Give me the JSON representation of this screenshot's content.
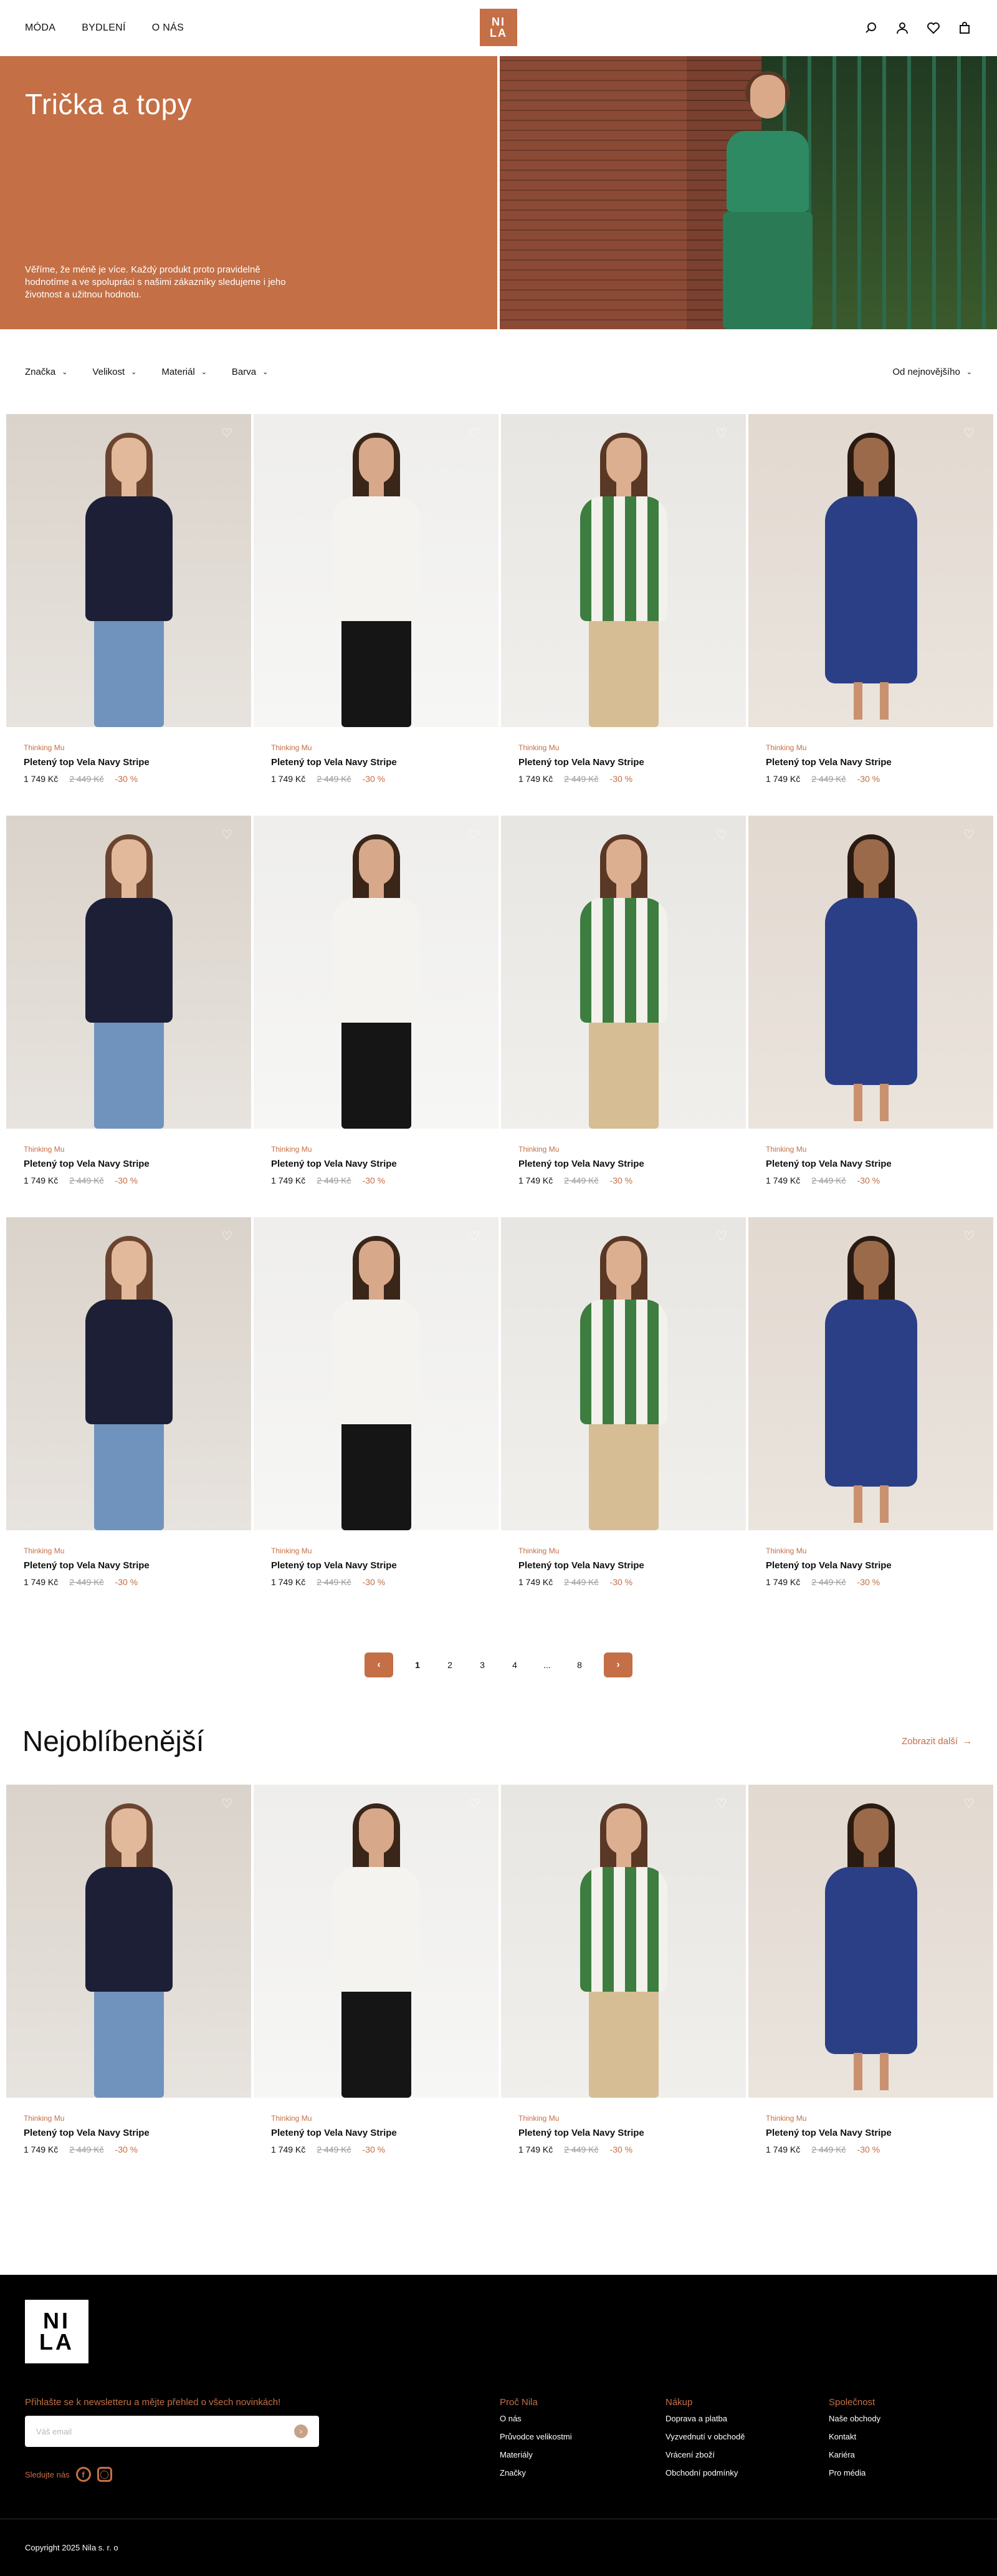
{
  "header": {
    "nav": [
      "MÓDA",
      "BYDLENÍ",
      "O NÁS"
    ],
    "logo_top": "NI",
    "logo_bottom": "LA",
    "icons": [
      "search-icon",
      "user-icon",
      "heart-icon",
      "bag-icon"
    ]
  },
  "hero": {
    "title": "Trička a topy",
    "text": "Věříme, že méně je více. Každý produkt proto pravidelně hodnotíme a ve spolupráci s našimi zákazníky sledujeme i jeho životnost a užitnou hodnotu."
  },
  "filters": {
    "items": [
      "Značka",
      "Velikost",
      "Materiál",
      "Barva"
    ],
    "sort": "Od nejnovějšího"
  },
  "products": [
    {
      "brand": "Thinking Mu",
      "name": "Pletený top Vela Navy Stripe",
      "price": "1 749 Kč",
      "old_price": "2 449 Kč",
      "discount": "-30 %"
    },
    {
      "brand": "Thinking Mu",
      "name": "Pletený top Vela Navy Stripe",
      "price": "1 749 Kč",
      "old_price": "2 449 Kč",
      "discount": "-30 %"
    },
    {
      "brand": "Thinking Mu",
      "name": "Pletený top Vela Navy Stripe",
      "price": "1 749 Kč",
      "old_price": "2 449 Kč",
      "discount": "-30 %"
    },
    {
      "brand": "Thinking Mu",
      "name": "Pletený top Vela Navy Stripe",
      "price": "1 749 Kč",
      "old_price": "2 449 Kč",
      "discount": "-30 %"
    }
  ],
  "pagination": {
    "pages": [
      "1",
      "2",
      "3",
      "4",
      "...",
      "8"
    ],
    "current": "1"
  },
  "popular": {
    "title": "Nejoblíbenější",
    "show_more": "Zobrazit další"
  },
  "footer": {
    "logo_top": "NI",
    "logo_bottom": "LA",
    "newsletter_title": "Přihlašte se k newsletteru a mějte přehled o všech novinkách!",
    "email_placeholder": "Váš email",
    "follow_label": "Sledujte nás",
    "columns": [
      {
        "title": "Proč Nila",
        "links": [
          "O nás",
          "Průvodce velikostmi",
          "Materiály",
          "Značky"
        ]
      },
      {
        "title": "Nákup",
        "links": [
          "Doprava a platba",
          "Vyzvednutí v obchodě",
          "Vrácení zboží",
          "Obchodní podmínky"
        ]
      },
      {
        "title": "Společnost",
        "links": [
          "Naše obchody",
          "Kontakt",
          "Kariéra",
          "Pro média"
        ]
      }
    ],
    "copyright": "Copyright 2025 Nila s. r. o"
  },
  "colors": {
    "accent": "#c46f45",
    "footer_bg": "#000000"
  }
}
